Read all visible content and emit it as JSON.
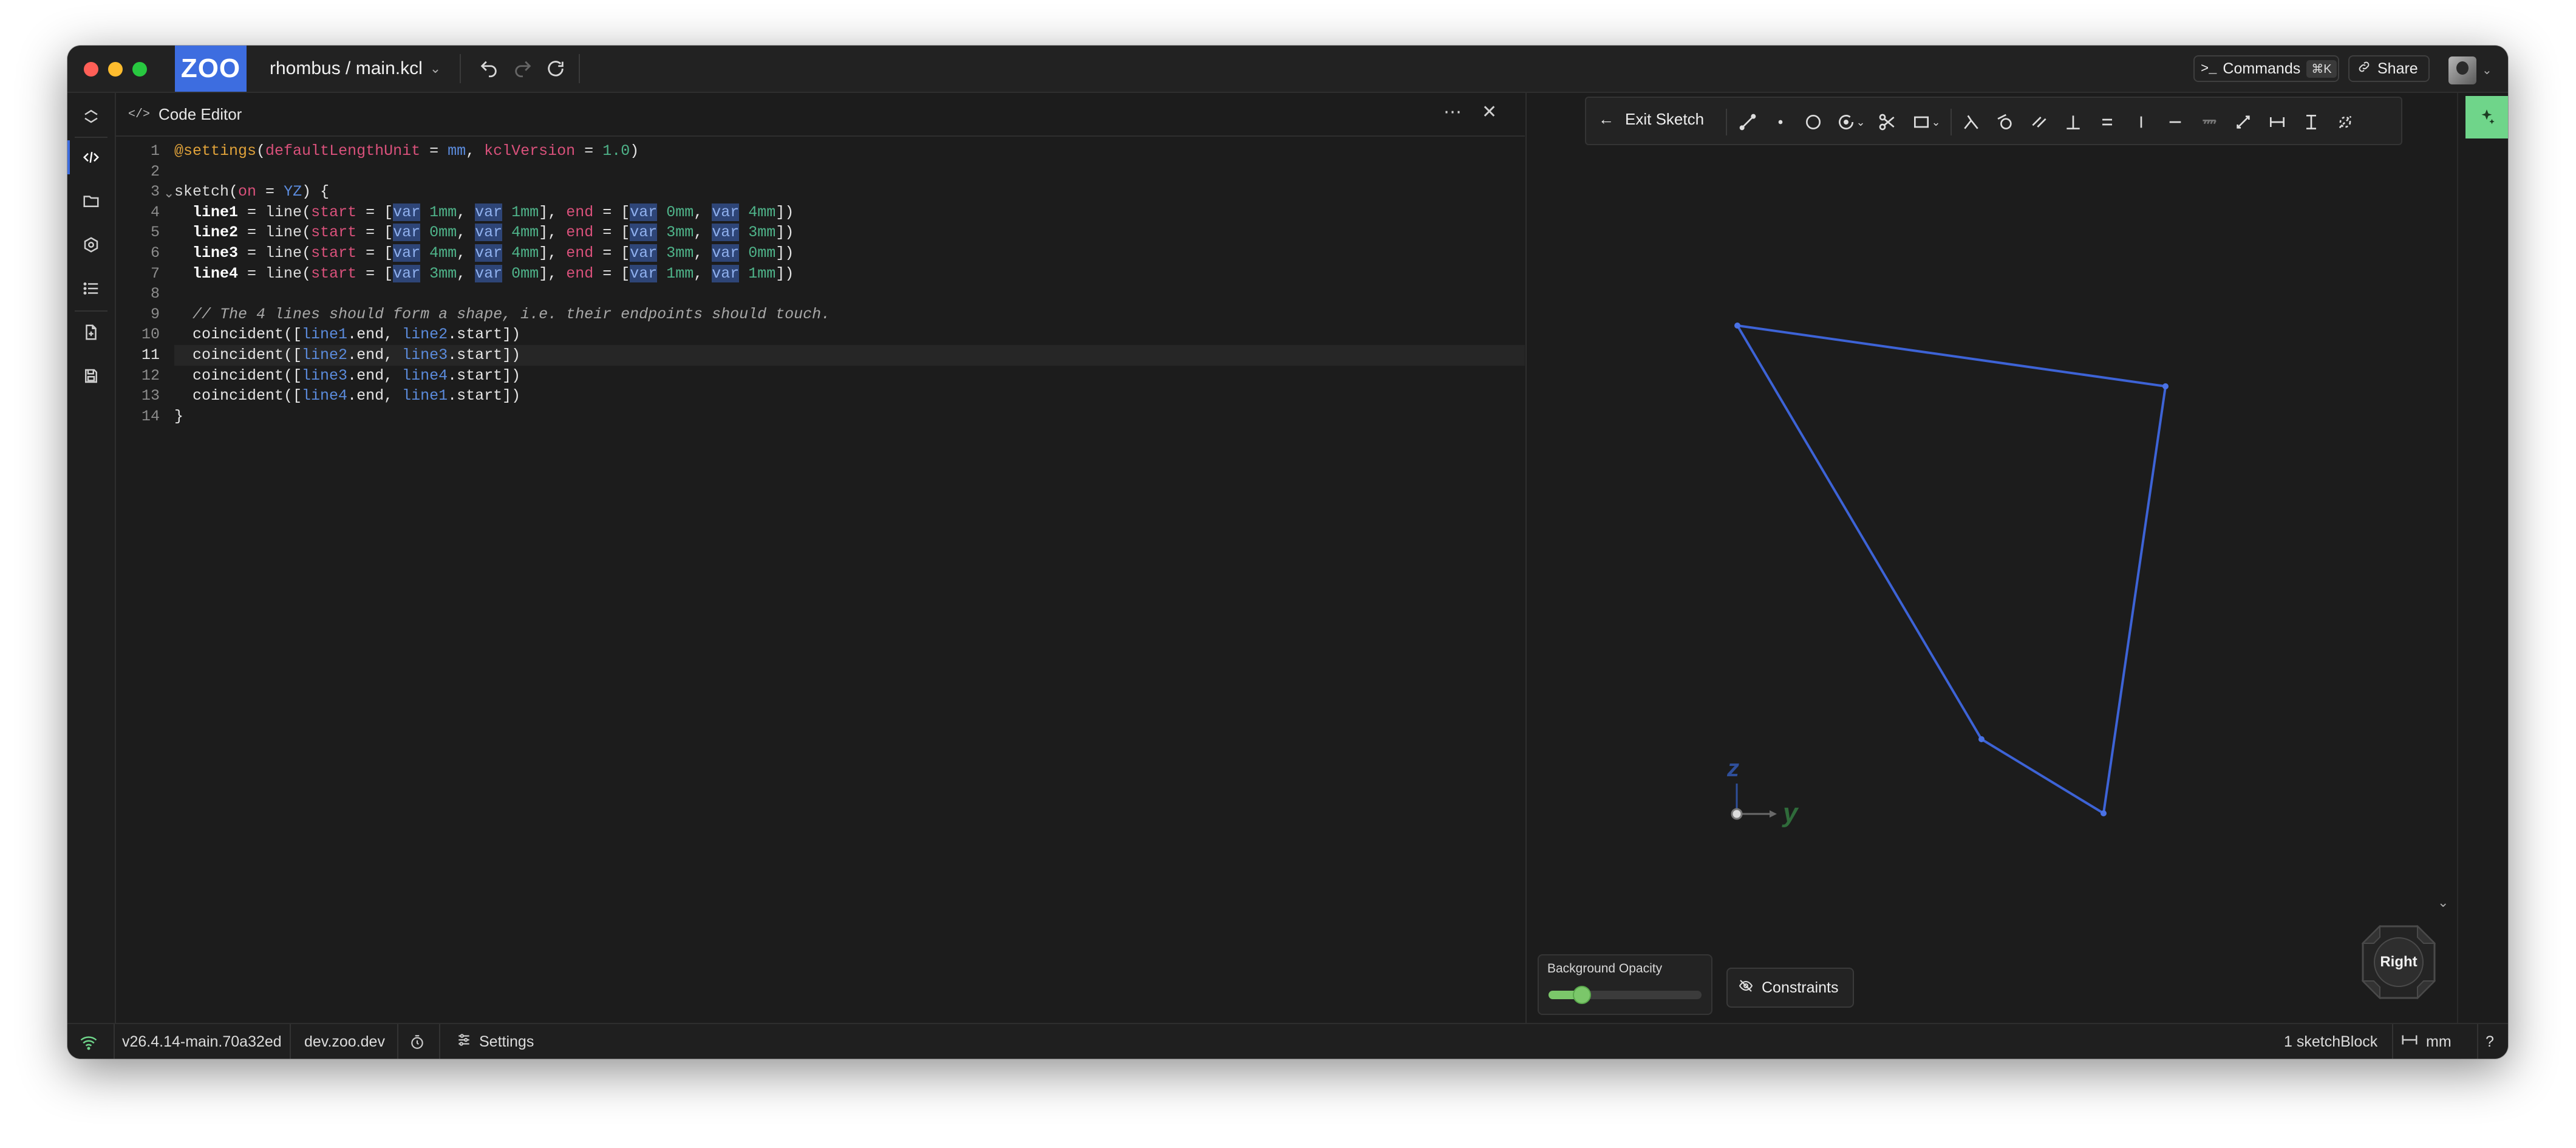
{
  "titlebar": {
    "logo": "ZOO",
    "project_path": "rhombus / main.kcl",
    "commands_label": "Commands",
    "commands_shortcut": "⌘K",
    "share_label": "Share"
  },
  "sidebar": {
    "items": [
      "collapse",
      "code",
      "files",
      "parts",
      "feature-tree",
      "add-file",
      "export"
    ]
  },
  "editor": {
    "title": "Code Editor",
    "line_numbers": [
      "1",
      "2",
      "3",
      "4",
      "5",
      "6",
      "7",
      "8",
      "9",
      "10",
      "11",
      "12",
      "13",
      "14"
    ]
  },
  "viewport": {
    "exit_sketch_label": "Exit Sketch",
    "background_opacity_label": "Background Opacity",
    "background_opacity": 0.22,
    "constraints_label": "Constraints",
    "view_label": "Right",
    "axis_z": "z",
    "axis_y": "y"
  },
  "statusbar": {
    "version": "v26.4.14-main.70a32ed",
    "env": "dev.zoo.dev",
    "settings_label": "Settings",
    "sketch_count": "1 sketchBlock",
    "unit": "mm",
    "help": "?"
  },
  "colors": {
    "accent": "#3d6de0",
    "sketch_line": "#3d63d6",
    "slider": "#7bc76a"
  }
}
